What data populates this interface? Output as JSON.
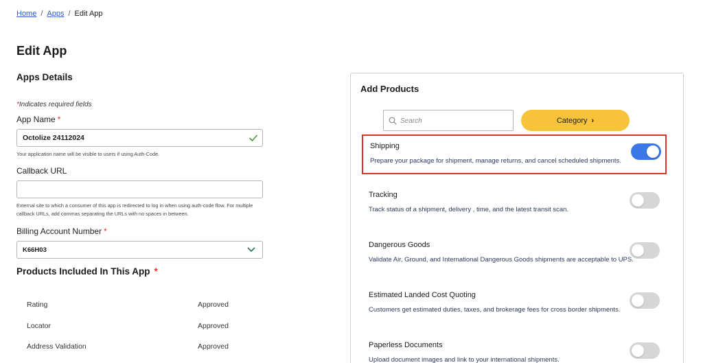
{
  "breadcrumb": {
    "home": "Home",
    "apps": "Apps",
    "sep": "/",
    "current": "Edit App"
  },
  "page_title": "Edit App",
  "details": {
    "title": "Apps Details",
    "required_star": "*",
    "required_note": "Indicates required fields",
    "app_name": {
      "label": "App Name",
      "star": "*",
      "value": "Octolize 24112024",
      "helper": "Your application name will be visible to users if using Auth-Code."
    },
    "callback": {
      "label": "Callback URL",
      "value": "",
      "helper": "External site to which a consumer of this app is redirected to log in when using auth-code flow. For multiple callback URLs, add commas separating the URLs with no spaces in between."
    },
    "billing": {
      "label": "Billing Account Number",
      "star": "*",
      "value": "K66H03"
    }
  },
  "included": {
    "title": "Products Included In This App",
    "star": "*",
    "rows": [
      {
        "name": "Rating",
        "status": "Approved"
      },
      {
        "name": "Locator",
        "status": "Approved"
      },
      {
        "name": "Address Validation",
        "status": "Approved"
      }
    ]
  },
  "add_products": {
    "title": "Add Products",
    "search_placeholder": "Search",
    "category_label": "Category",
    "category_chevron": "›",
    "items": [
      {
        "name": "Shipping",
        "desc": "Prepare your package for shipment, manage returns, and cancel scheduled shipments.",
        "enabled": true
      },
      {
        "name": "Tracking",
        "desc": "Track status of a shipment, delivery , time, and the latest transit scan.",
        "enabled": false
      },
      {
        "name": "Dangerous Goods",
        "desc": "Validate Air, Ground, and International Dangerous Goods shipments are acceptable to UPS.",
        "enabled": false
      },
      {
        "name": "Estimated Landed Cost Quoting",
        "desc": "Customers get estimated duties, taxes, and brokerage fees for cross border shipments.",
        "enabled": false
      },
      {
        "name": "Paperless Documents",
        "desc": "Upload document images and link to your international shipments.",
        "enabled": false
      }
    ]
  },
  "colors": {
    "accent": "#3b78e7",
    "category": "#f6c33b",
    "required": "#e0302a",
    "highlight": "#e0302a",
    "link": "#2b57c9",
    "valid": "#4a9a3a"
  }
}
